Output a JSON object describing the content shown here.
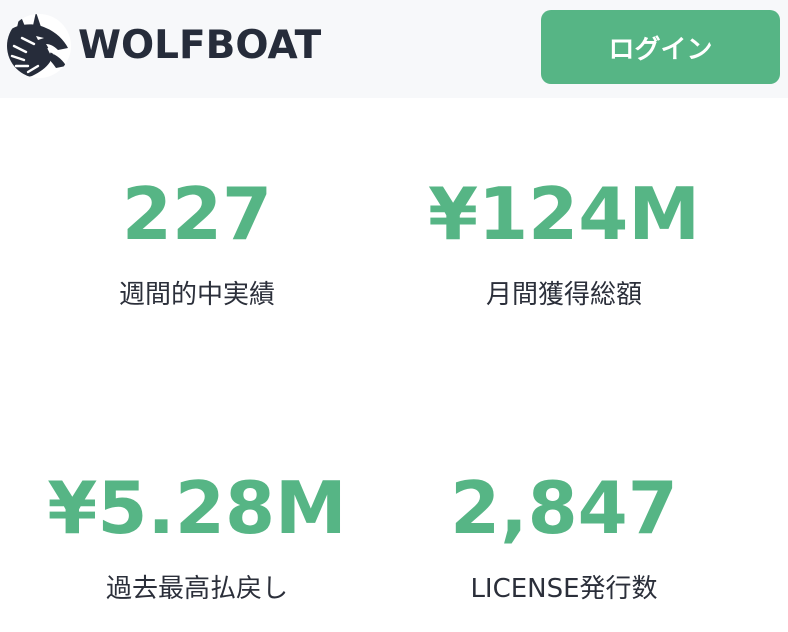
{
  "header": {
    "brand": "WOLFBOAT",
    "login_label": "ログイン",
    "logo_icon": "wolf-head-icon"
  },
  "stats": [
    {
      "value": "227",
      "label": "週間的中実績"
    },
    {
      "value": "¥124M",
      "label": "月間獲得総額"
    },
    {
      "value": "¥5.28M",
      "label": "過去最高払戻し"
    },
    {
      "value": "2,847",
      "label": "LICENSE発行数"
    }
  ],
  "colors": {
    "accent": "#56b585",
    "brand_text": "#262c3a",
    "label_text": "#2b2f3a",
    "header_bg": "#f7f8fa"
  }
}
